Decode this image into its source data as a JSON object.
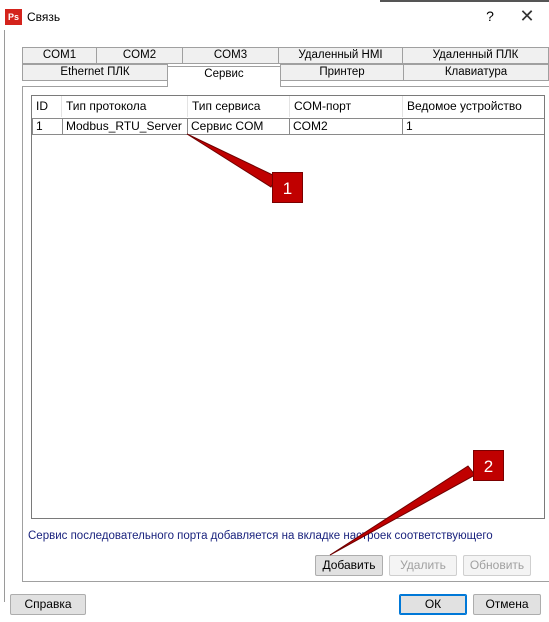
{
  "window": {
    "app_icon_text": "Ps",
    "title": "Связь",
    "help_label": "?",
    "close_label": "✕"
  },
  "tabs_row1": [
    {
      "label": "COM1"
    },
    {
      "label": "COM2"
    },
    {
      "label": "COM3"
    },
    {
      "label": "Удаленный HMI"
    },
    {
      "label": "Удаленный ПЛК"
    }
  ],
  "tabs_row2": [
    {
      "label": "Ethernet ПЛК"
    },
    {
      "label": "Сервис",
      "active": true
    },
    {
      "label": "Принтер"
    },
    {
      "label": "Клавиатура"
    }
  ],
  "table": {
    "columns": [
      "ID",
      "Тип протокола",
      "Тип сервиса",
      "COM-порт",
      "Ведомое устройство"
    ],
    "rows": [
      [
        "1",
        "Modbus_RTU_Server",
        "Сервис COM",
        "COM2",
        "1"
      ]
    ]
  },
  "note": "Сервис последовательного порта добавляется на вкладке настроек соответствующего",
  "buttons": {
    "add": "Добавить",
    "delete": "Удалить",
    "refresh": "Обновить",
    "help": "Справка",
    "ok": "ОК",
    "cancel": "Отмена"
  },
  "callouts": [
    {
      "label": "1"
    },
    {
      "label": "2"
    }
  ],
  "colors": {
    "callout": "#c00000",
    "note_text": "#1a237e",
    "default_button_border": "#0078d7"
  }
}
